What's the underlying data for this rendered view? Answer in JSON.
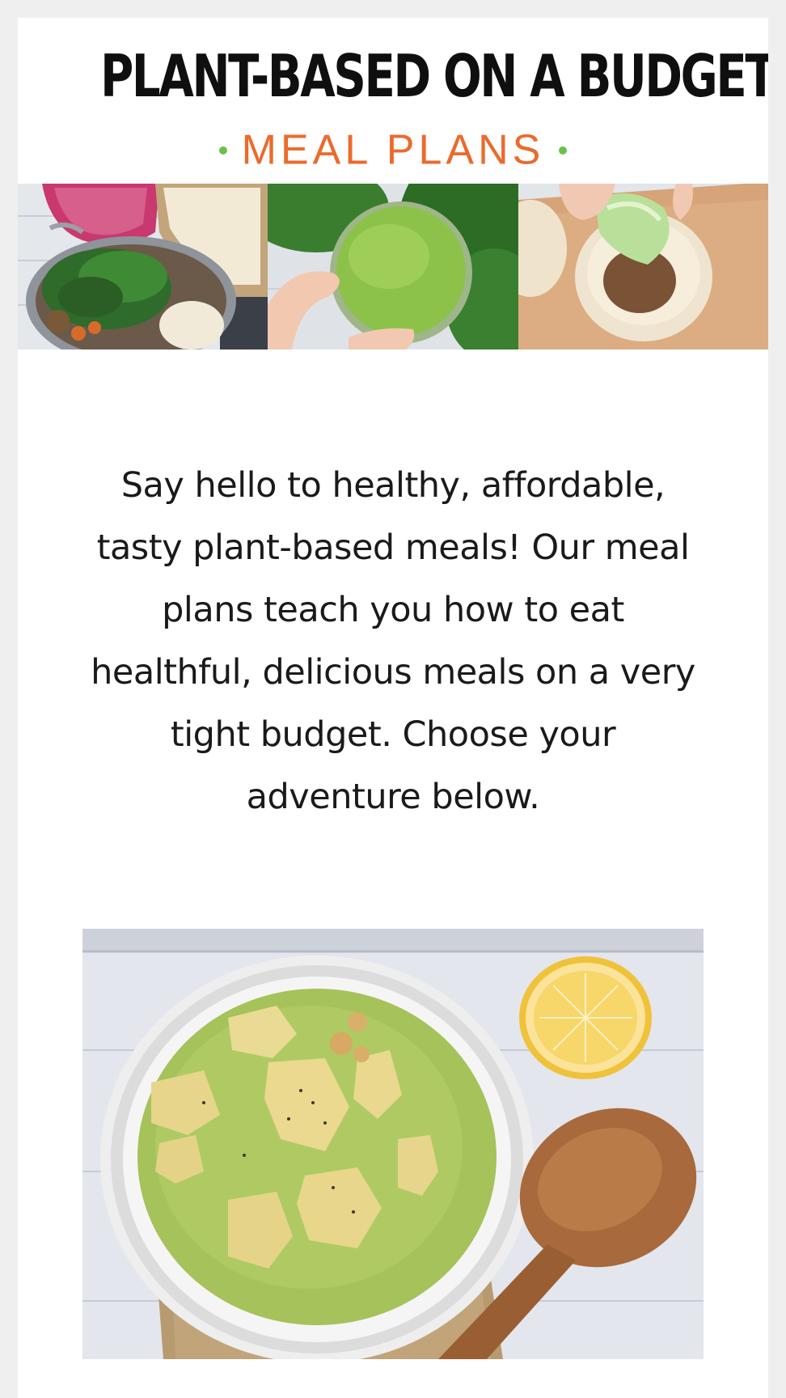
{
  "header": {
    "title": "PLANT-BASED ON A BUDGET",
    "subtitle": "MEAL PLANS",
    "title_color": "#0f0f0f",
    "subtitle_color": "#ec6a2c",
    "dot_color": "#6cc04a"
  },
  "hero_strip": {
    "photos": [
      {
        "subject": "pot of kale, lentils and cauliflower rice"
      },
      {
        "subject": "glass of green smoothie with kale"
      },
      {
        "subject": "tortilla wrap with lentils and lettuce"
      }
    ]
  },
  "intro": {
    "text": "Say hello to healthy, affordable, tasty plant-based meals! Our meal plans teach you how to eat healthful, delicious meals on a very tight budget. Choose your adventure below."
  },
  "feature_photo": {
    "subject": "bowl of green pea and potato soup with lemon and wooden spoon"
  }
}
